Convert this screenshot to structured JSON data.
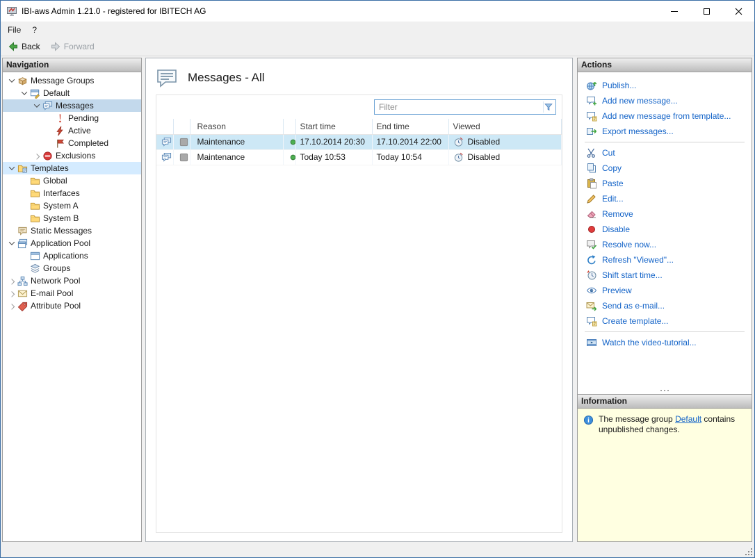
{
  "window": {
    "title": "IBI-aws Admin 1.21.0 - registered for IBITECH AG"
  },
  "menu": {
    "items": [
      {
        "label": "File"
      },
      {
        "label": "?"
      }
    ]
  },
  "toolbar": {
    "back_label": "Back",
    "forward_label": "Forward"
  },
  "navigation": {
    "header": "Navigation",
    "items": [
      {
        "label": "Message Groups",
        "icon": "message-groups-icon",
        "expanded": true
      },
      {
        "label": "Default",
        "icon": "message-group-icon",
        "expanded": true
      },
      {
        "label": "Messages",
        "icon": "messages-icon",
        "expanded": true,
        "selected": true
      },
      {
        "label": "Pending",
        "icon": "pending-icon"
      },
      {
        "label": "Active",
        "icon": "active-icon"
      },
      {
        "label": "Completed",
        "icon": "completed-icon"
      },
      {
        "label": "Exclusions",
        "icon": "exclusions-icon",
        "expanded": false
      },
      {
        "label": "Templates",
        "icon": "templates-icon",
        "expanded": true,
        "highlighted": true
      },
      {
        "label": "Global",
        "icon": "folder-icon"
      },
      {
        "label": "Interfaces",
        "icon": "folder-icon"
      },
      {
        "label": "System A",
        "icon": "folder-icon"
      },
      {
        "label": "System B",
        "icon": "folder-icon"
      },
      {
        "label": "Static Messages",
        "icon": "static-messages-icon"
      },
      {
        "label": "Application Pool",
        "icon": "application-pool-icon",
        "expanded": true
      },
      {
        "label": "Applications",
        "icon": "applications-icon"
      },
      {
        "label": "Groups",
        "icon": "groups-icon"
      },
      {
        "label": "Network Pool",
        "icon": "network-pool-icon",
        "expanded": false
      },
      {
        "label": "E-mail Pool",
        "icon": "email-pool-icon",
        "expanded": false
      },
      {
        "label": "Attribute Pool",
        "icon": "attribute-pool-icon",
        "expanded": false
      }
    ]
  },
  "main": {
    "title": "Messages - All",
    "filter_placeholder": "Filter",
    "table": {
      "columns": [
        "Reason",
        "Start time",
        "End time",
        "Viewed"
      ],
      "rows": [
        {
          "reason": "Maintenance",
          "status": "active",
          "start_time": "17.10.2014 20:30",
          "end_time": "17.10.2014 22:00",
          "viewed": "Disabled",
          "selected": true
        },
        {
          "reason": "Maintenance",
          "status": "active",
          "start_time": "Today 10:53",
          "end_time": "Today 10:54",
          "viewed": "Disabled",
          "selected": false
        }
      ]
    }
  },
  "actions": {
    "header": "Actions",
    "items": [
      {
        "label": "Publish...",
        "icon": "publish-icon"
      },
      {
        "label": "Add new message...",
        "icon": "add-message-icon"
      },
      {
        "label": "Add new message from template...",
        "icon": "add-message-from-template-icon"
      },
      {
        "label": "Export messages...",
        "icon": "export-messages-icon"
      },
      {
        "label": "Cut",
        "icon": "cut-icon"
      },
      {
        "label": "Copy",
        "icon": "copy-icon"
      },
      {
        "label": "Paste",
        "icon": "paste-icon"
      },
      {
        "label": "Edit...",
        "icon": "edit-icon"
      },
      {
        "label": "Remove",
        "icon": "remove-icon"
      },
      {
        "label": "Disable",
        "icon": "disable-icon"
      },
      {
        "label": "Resolve now...",
        "icon": "resolve-icon"
      },
      {
        "label": "Refresh \"Viewed\"...",
        "icon": "refresh-viewed-icon"
      },
      {
        "label": "Shift start time...",
        "icon": "shift-start-time-icon"
      },
      {
        "label": "Preview",
        "icon": "preview-icon"
      },
      {
        "label": "Send as e-mail...",
        "icon": "send-email-icon"
      },
      {
        "label": "Create template...",
        "icon": "create-template-icon"
      },
      {
        "label": "Watch the video-tutorial...",
        "icon": "video-tutorial-icon"
      }
    ]
  },
  "information": {
    "header": "Information",
    "text_before": "The message group ",
    "link_text": "Default",
    "text_after": " contains unpublished changes."
  },
  "colors": {
    "accent_link": "#1464c8",
    "selection": "#cde8f6",
    "info_bg": "#ffffe1"
  }
}
